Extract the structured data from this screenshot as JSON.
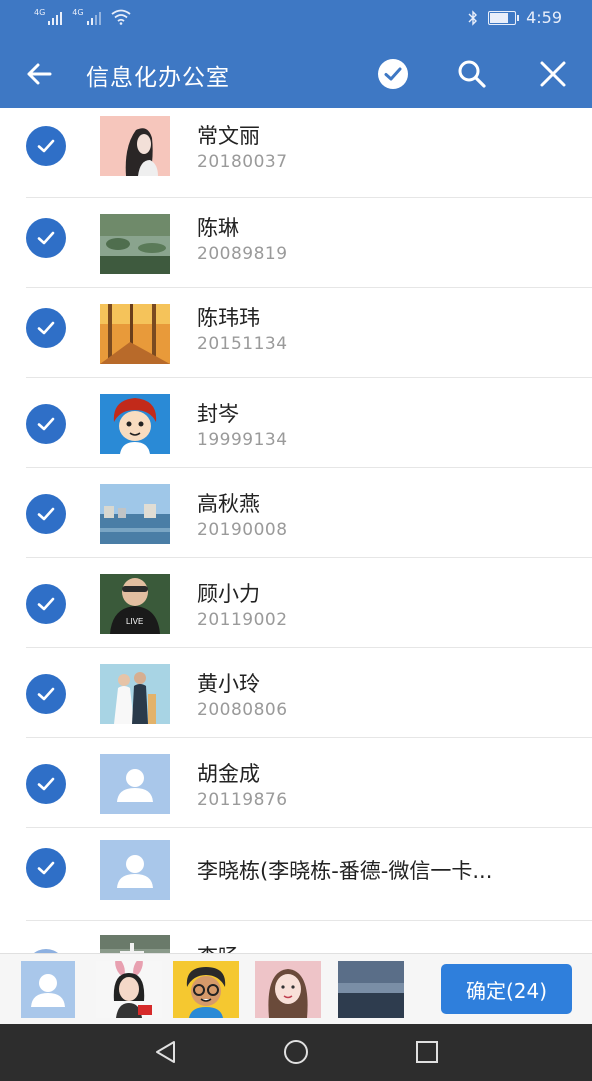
{
  "status_bar": {
    "time": "4:59",
    "network_1": "4G",
    "network_2": "4G"
  },
  "app_bar": {
    "title": "信息化办公室"
  },
  "contacts": [
    {
      "name": "常文丽",
      "code": "20180037"
    },
    {
      "name": "陈琳",
      "code": "20089819"
    },
    {
      "name": "陈玮玮",
      "code": "20151134"
    },
    {
      "name": "封岑",
      "code": "19999134"
    },
    {
      "name": "高秋燕",
      "code": "20190008"
    },
    {
      "name": "顾小力",
      "code": "20119002"
    },
    {
      "name": "黄小玲",
      "code": "20080806"
    },
    {
      "name": "胡金成",
      "code": "20119876"
    },
    {
      "name": "李晓栋(李晓栋-番德-微信一卡..."
    },
    {
      "name": "李旸"
    }
  ],
  "bottom_bar": {
    "confirm_label": "确定(24)"
  },
  "colors": {
    "primary": "#3e78c4",
    "check": "#2f6fc7",
    "button": "#2f7fdc",
    "nav": "#2d2d2d"
  }
}
